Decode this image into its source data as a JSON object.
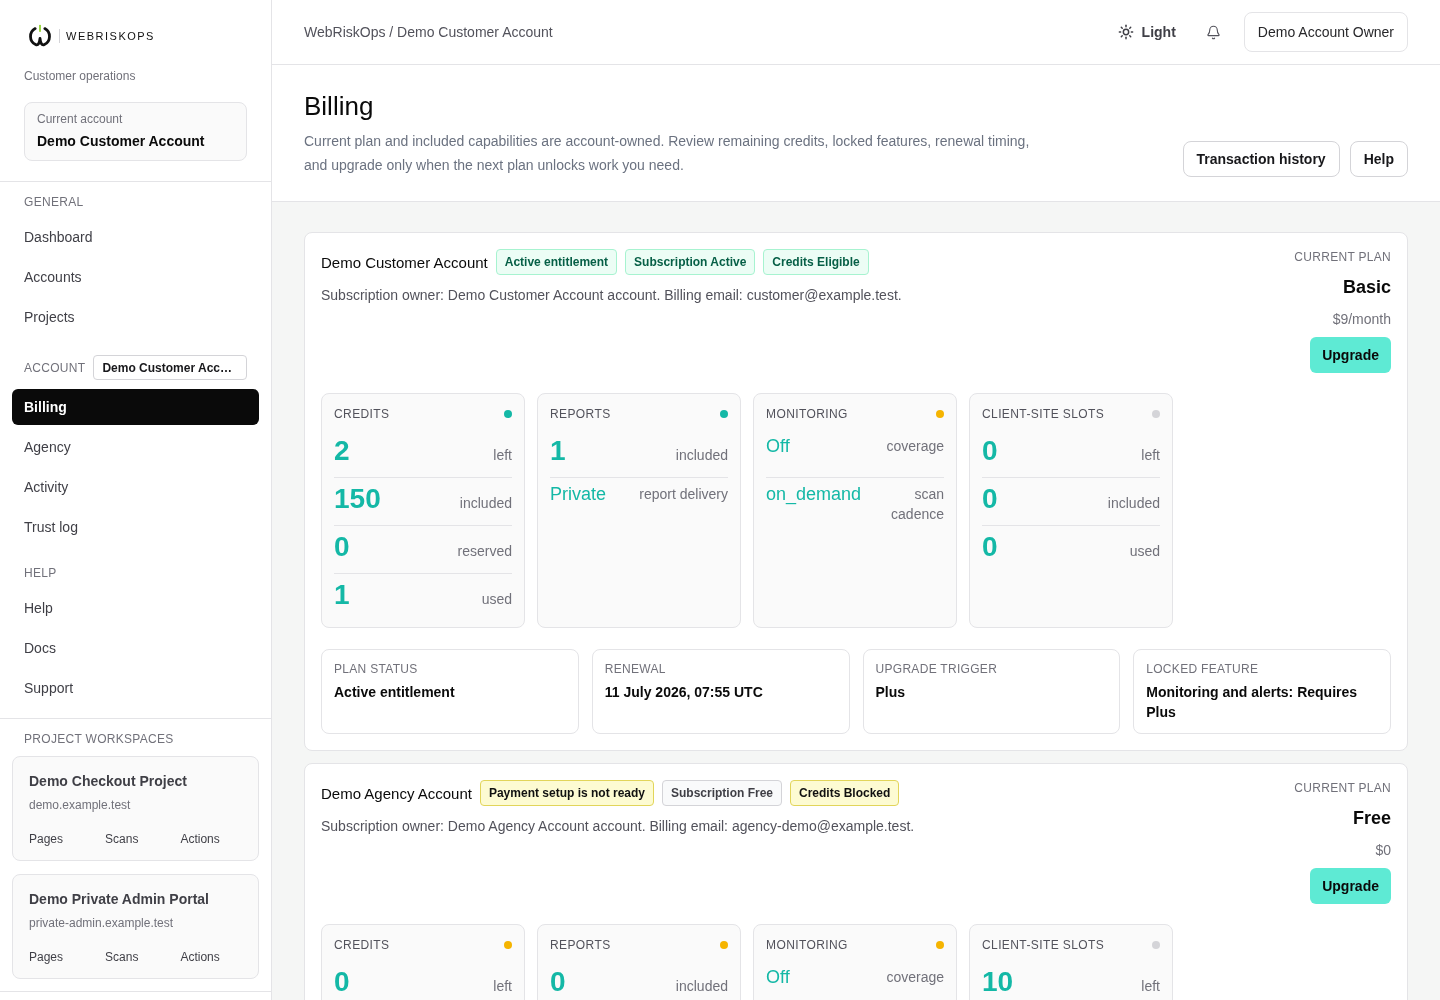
{
  "sidebar": {
    "brand": "WEBRISKOPS",
    "subtitle": "Customer operations",
    "current_account": {
      "label": "Current account",
      "name": "Demo Customer Account"
    },
    "sections": [
      {
        "title": "GENERAL",
        "items": [
          {
            "label": "Dashboard",
            "selected": false
          },
          {
            "label": "Accounts",
            "selected": false
          },
          {
            "label": "Projects",
            "selected": false
          }
        ]
      },
      {
        "title": "ACCOUNT",
        "account_chip": "Demo Customer Acc…",
        "items": [
          {
            "label": "Billing",
            "selected": true
          },
          {
            "label": "Agency",
            "selected": false
          },
          {
            "label": "Activity",
            "selected": false
          },
          {
            "label": "Trust log",
            "selected": false
          }
        ]
      },
      {
        "title": "HELP",
        "items": [
          {
            "label": "Help",
            "selected": false
          },
          {
            "label": "Docs",
            "selected": false
          },
          {
            "label": "Support",
            "selected": false
          }
        ]
      }
    ],
    "workspaces": {
      "title": "PROJECT WORKSPACES",
      "projects": [
        {
          "name": "Demo Checkout Project",
          "domain": "demo.example.test",
          "links": [
            "Pages",
            "Scans",
            "Actions"
          ]
        },
        {
          "name": "Demo Private Admin Portal",
          "domain": "private-admin.example.test",
          "links": [
            "Pages",
            "Scans",
            "Actions"
          ]
        }
      ]
    }
  },
  "topbar": {
    "breadcrumb": "WebRiskOps / Demo Customer Account",
    "theme_toggle": "Light",
    "user_button": "Demo Account Owner"
  },
  "page": {
    "title": "Billing",
    "description": "Current plan and included capabilities are account-owned. Review remaining credits, locked features, renewal timing, and upgrade only when the next plan unlocks work you need.",
    "actions": [
      "Transaction history",
      "Help"
    ]
  },
  "accounts": [
    {
      "name": "Demo Customer Account",
      "badges": [
        {
          "label": "Active entitlement",
          "kind": "success"
        },
        {
          "label": "Subscription Active",
          "kind": "success"
        },
        {
          "label": "Credits Eligible",
          "kind": "success"
        }
      ],
      "owner_text": "Subscription owner: Demo Customer Account account. Billing email: customer@example.test.",
      "plan": {
        "label": "CURRENT PLAN",
        "name": "Basic",
        "price": "$9/month",
        "button": "Upgrade"
      },
      "tiles": [
        {
          "title": "CREDITS",
          "color": "#14b8a6",
          "rows": [
            {
              "kind": "number",
              "value": "2",
              "label": "left"
            },
            {
              "kind": "number",
              "value": "150",
              "label": "included"
            },
            {
              "kind": "number",
              "value": "0",
              "label": "reserved"
            },
            {
              "kind": "number",
              "value": "1",
              "label": "used"
            }
          ]
        },
        {
          "title": "REPORTS",
          "color": "#14b8a6",
          "rows": [
            {
              "kind": "number",
              "value": "1",
              "label": "included"
            },
            {
              "kind": "text",
              "value": "Private",
              "label": "report delivery"
            }
          ]
        },
        {
          "title": "MONITORING",
          "color": "#f5b400",
          "rows": [
            {
              "kind": "text",
              "value": "Off",
              "label": "coverage"
            },
            {
              "kind": "text",
              "value": "on_demand",
              "label": "scan cadence"
            }
          ]
        },
        {
          "title": "CLIENT-SITE SLOTS",
          "color": "#d4d4d8",
          "rows": [
            {
              "kind": "number",
              "value": "0",
              "label": "left"
            },
            {
              "kind": "number",
              "value": "0",
              "label": "included"
            },
            {
              "kind": "number",
              "value": "0",
              "label": "used"
            }
          ]
        }
      ],
      "summary": [
        {
          "label": "PLAN STATUS",
          "value": "Active entitlement"
        },
        {
          "label": "RENEWAL",
          "value": "11 July 2026, 07:55 UTC"
        },
        {
          "label": "UPGRADE TRIGGER",
          "value": "Plus"
        },
        {
          "label": "LOCKED FEATURE",
          "value": "Monitoring and alerts: Requires Plus"
        }
      ]
    },
    {
      "name": "Demo Agency Account",
      "badges": [
        {
          "label": "Payment setup is not ready",
          "kind": "warning"
        },
        {
          "label": "Subscription Free",
          "kind": "neutral"
        },
        {
          "label": "Credits Blocked",
          "kind": "warning"
        }
      ],
      "owner_text": "Subscription owner: Demo Agency Account account. Billing email: agency-demo@example.test.",
      "plan": {
        "label": "CURRENT PLAN",
        "name": "Free",
        "price": "$0",
        "button": "Upgrade"
      },
      "tiles": [
        {
          "title": "CREDITS",
          "color": "#f5b400",
          "rows": [
            {
              "kind": "number",
              "value": "0",
              "label": "left"
            }
          ]
        },
        {
          "title": "REPORTS",
          "color": "#f5b400",
          "rows": [
            {
              "kind": "number",
              "value": "0",
              "label": "included"
            }
          ]
        },
        {
          "title": "MONITORING",
          "color": "#f5b400",
          "rows": [
            {
              "kind": "text",
              "value": "Off",
              "label": "coverage"
            }
          ]
        },
        {
          "title": "CLIENT-SITE SLOTS",
          "color": "#d4d4d8",
          "rows": [
            {
              "kind": "number",
              "value": "10",
              "label": "left"
            }
          ]
        }
      ]
    }
  ]
}
